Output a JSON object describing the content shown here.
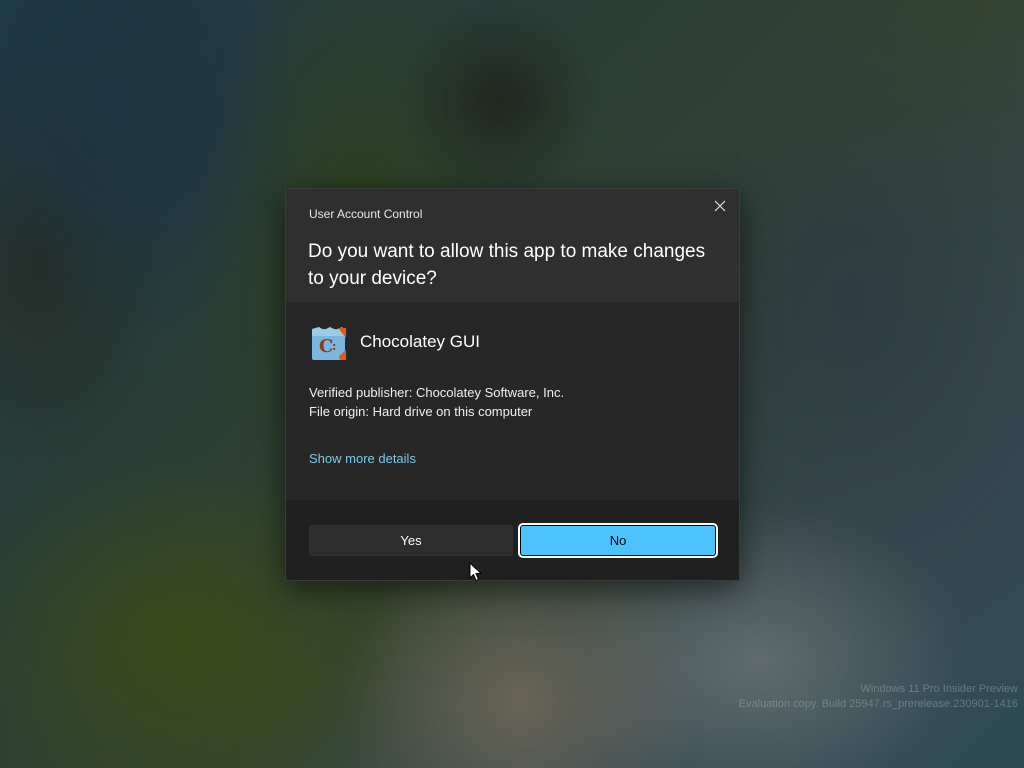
{
  "desktop": {
    "watermark_line1": "Windows 11 Pro Insider Preview",
    "watermark_line2": "Evaluation copy. Build 25947.rs_prerelease.230901-1416"
  },
  "dialog": {
    "title": "User Account Control",
    "question": "Do you want to allow this app to make changes to your device?",
    "app_name": "Chocolatey GUI",
    "publisher_label": "Verified publisher: ",
    "publisher_value": "Chocolatey Software, Inc.",
    "origin_label": "File origin: ",
    "origin_value": "Hard drive on this computer",
    "details_link": "Show more details",
    "yes_label": "Yes",
    "no_label": "No",
    "close_icon": "close-icon",
    "app_icon": "chocolatey-icon"
  },
  "colors": {
    "accent": "#4cc2ff",
    "link": "#7cc8e6",
    "dialog_bg": "#2b2b2b",
    "footer_bg": "#202020"
  }
}
